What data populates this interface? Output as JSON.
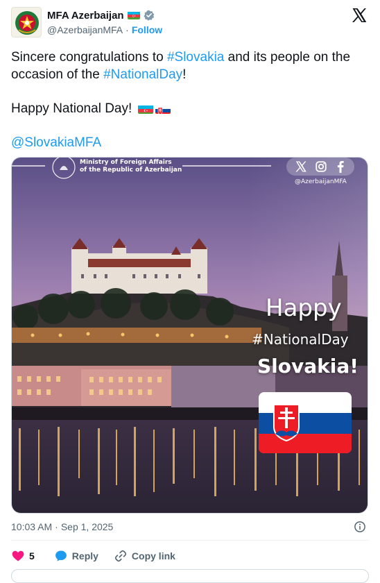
{
  "account": {
    "display_name": "MFA Azerbaijan",
    "handle": "@AzerbaijanMFA",
    "separator": "·",
    "follow_label": "Follow"
  },
  "tweet": {
    "line1_pre": "Sincere congratulations to ",
    "hashtag1": "#Slovakia",
    "line1_mid": " and its people on the occasion of the ",
    "hashtag2": "#NationalDay",
    "line1_post": "!",
    "line2": "Happy National Day!",
    "mention": "@SlovakiaMFA"
  },
  "media": {
    "ministry_line1": "Ministry of Foreign Affairs",
    "ministry_line2": "of the Republic of Azerbaijan",
    "social_handle": "@AzerbaijanMFA",
    "happy": "Happy",
    "hashtag": "#NationalDay",
    "country": "Slovakia!"
  },
  "footer": {
    "time": "10:03 AM",
    "separator": "·",
    "date": "Sep 1, 2025"
  },
  "actions": {
    "like_count": "5",
    "reply_label": "Reply",
    "copy_label": "Copy link"
  },
  "colors": {
    "link": "#1d9bf0",
    "like": "#f91880",
    "reply": "#1d9bf0"
  }
}
